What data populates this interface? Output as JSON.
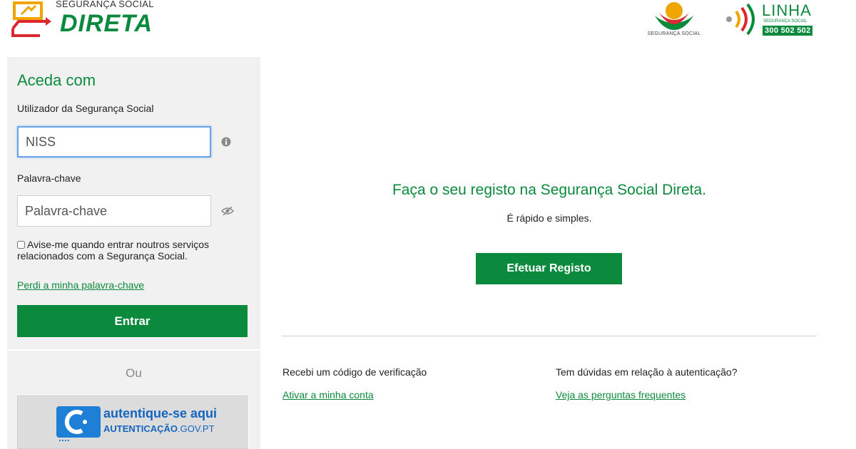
{
  "header": {
    "brand_small": "SEGURANÇA SOCIAL",
    "brand_big": "DIRETA",
    "ss_logo_text": "SEGURANÇA SOCIAL",
    "linha_word": "LINHA",
    "linha_sub": "SEGURANÇA SOCIAL",
    "linha_phone": "300 502 502"
  },
  "login": {
    "title": "Aceda com",
    "user_label": "Utilizador da Segurança Social",
    "user_placeholder": "NISS",
    "user_icon": "info-icon",
    "password_label": "Palavra-chave",
    "password_placeholder": "Palavra-chave",
    "password_icon": "eye-slash-icon",
    "remember_text": "Avise-me quando entrar noutros serviços relacionados com a Segurança Social.",
    "remember_checked": false,
    "forgot_link": "Perdi a minha palavra-chave",
    "submit_label": "Entrar"
  },
  "alternative": {
    "or_text": "Ou",
    "autgov_line1": "autentique-se aqui",
    "autgov_line2_bold": "AUTENTICAÇÃO",
    "autgov_line2_rest": ".GOV.PT"
  },
  "register": {
    "title": "Faça o seu registo na Segurança Social Direta.",
    "subtitle": "É rápido e simples.",
    "button_label": "Efetuar Registo"
  },
  "help": {
    "left_label": "Recebi um código de verificação",
    "left_link": "Ativar a minha conta",
    "right_label": "Tem dúvidas em relação à autenticação?",
    "right_link": "Veja as perguntas frequentes"
  },
  "colors": {
    "brand_green": "#0b8a3d",
    "panel_bg": "#f1f1f1",
    "autgov_blue": "#1565c0",
    "logo_orange": "#f0a500",
    "logo_red": "#d9282f"
  }
}
